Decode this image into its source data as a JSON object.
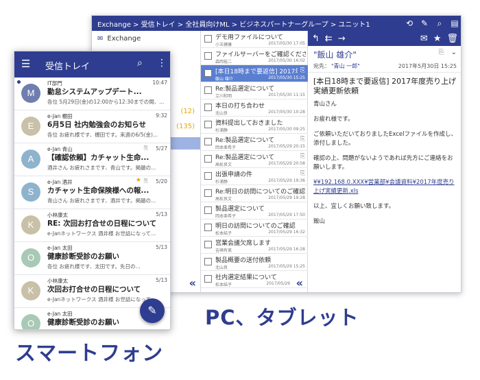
{
  "colors": {
    "brand": "#2e3d8f",
    "selected_row": "#5b7fd0",
    "sidebar_selected": "#9fb3e3",
    "badge": "#e8a400"
  },
  "pc": {
    "breadcrumb": "Exchange > 受信トレイ > 全社員向けML > ビジネスパートナーグループ > ユニット1",
    "toolbar_icons": [
      "sync-icon",
      "edit-icon",
      "search-icon",
      "panel-icon"
    ],
    "folders": [
      {
        "label": "Exchange",
        "icon": "mail-icon",
        "count": ""
      },
      {
        "label": "",
        "count": "(12)"
      },
      {
        "label": "",
        "count": "(135)"
      }
    ],
    "messages": [
      {
        "subject": "デモ用ファイルについて",
        "from": "小玉健康",
        "date": "2017/05/30 17:05",
        "clip": false,
        "selected": false
      },
      {
        "subject": "ファイルサーバーをご確認ください",
        "from": "森岡裕二",
        "date": "2017/05/30 16:02",
        "clip": false,
        "selected": false
      },
      {
        "subject": "[本日18時まで要返信] 2017年度売り上げ実績更新依頼",
        "from": "飯山 雄介",
        "date": "2017/05/30 15:25",
        "clip": true,
        "selected": true
      },
      {
        "subject": "Re:製品選定について",
        "from": "立川和明",
        "date": "2017/05/30 11:15",
        "clip": false,
        "selected": false
      },
      {
        "subject": "本日の打ち合わせ",
        "from": "北山良",
        "date": "2017/05/30 10:28",
        "clip": false,
        "selected": false
      },
      {
        "subject": "資料提出しておきました",
        "from": "杉浦静",
        "date": "2017/05/30 09:25",
        "clip": false,
        "selected": false
      },
      {
        "subject": "Re:製品選定について",
        "from": "岡本亜希子",
        "date": "2017/05/29 20:15",
        "clip": true,
        "selected": false
      },
      {
        "subject": "Re:製品選定について",
        "from": "高松良文",
        "date": "2017/05/29 20:58",
        "clip": true,
        "selected": false
      },
      {
        "subject": "出張申請の件",
        "from": "杉浦静",
        "date": "2017/05/29 19:36",
        "clip": true,
        "selected": false
      },
      {
        "subject": "Re:明日の訪問についてのご確認",
        "from": "高松良文",
        "date": "2017/05/29 19:28",
        "clip": false,
        "selected": false
      },
      {
        "subject": "製品選定について",
        "from": "岡本亜希子",
        "date": "2017/05/29 17:50",
        "clip": false,
        "selected": false
      },
      {
        "subject": "明日の訪問についてのご確認",
        "from": "松本結子",
        "date": "2017/05/29 16:32",
        "clip": false,
        "selected": false
      },
      {
        "subject": "営業会議欠席します",
        "from": "吉崎有美",
        "date": "2017/05/29 16:28",
        "clip": false,
        "selected": false
      },
      {
        "subject": "製品概要の送付依頼",
        "from": "北山良",
        "date": "2017/05/29 15:25",
        "clip": false,
        "selected": false
      },
      {
        "subject": "社内選定結果について",
        "from": "松本結子",
        "date": "2017/05/29",
        "clip": false,
        "selected": false
      }
    ],
    "reader": {
      "sender": "\"飯山 雄介\"",
      "to_label": "宛先：",
      "to": "\"青山 一郎\"",
      "date": "2017年5月30日 15:25",
      "subject": "[本日18時まで要返信] 2017年度売り上げ実績更新依頼",
      "greeting": "青山さん",
      "line1": "お疲れ様です。",
      "line2": "ご依頼いただいておりましたExcelファイルを作成し、添付しました。",
      "line3": "確認の上、問題がないようであれば先方にご連絡をお願いします。",
      "link": "¥¥192.168.0.XXX¥営業部¥会議資料¥2017年度売り上げ実績更新.xls",
      "closing": "以上、宜しくお願い致します。",
      "signature": "飯山"
    }
  },
  "phone": {
    "title": "受信トレイ",
    "items": [
      {
        "avatar": "M",
        "color": "#6f7eaf",
        "unread": true,
        "from": "IT部門",
        "date": "10:47",
        "subject": "勤怠システムアップデート...",
        "preview": "各位 5月29日(金)の12:00から12:30までの間、...",
        "clip": false,
        "star": false
      },
      {
        "avatar": "E",
        "color": "#c9c0a8",
        "unread": false,
        "from": "e-Jan 棚田",
        "date": "9:32",
        "subject": "6月5日 社内勉強会のお知らせ",
        "preview": "各位 お疲れ様です、棚田です。来週の6/5(金)...",
        "clip": false,
        "star": false
      },
      {
        "avatar": "A",
        "color": "#8fb3cd",
        "unread": false,
        "from": "e-Jan 青山",
        "date": "5/27",
        "subject": "【確認依頼】カチャット生命...",
        "preview": "酒井さん お疲れさまです、青山です。掲題の...",
        "clip": true,
        "star": false
      },
      {
        "avatar": "S",
        "color": "#8fb3cd",
        "unread": false,
        "from": "e-Jan 酒井",
        "date": "5/20",
        "subject": "カチャット生命保険様への報...",
        "preview": "青山さん お疲れさまです、酒井です。掲題の...",
        "clip": true,
        "star": true
      },
      {
        "avatar": "K",
        "color": "#c9c0a8",
        "unread": false,
        "from": "小林康太",
        "date": "5/13",
        "subject": "RE: 次回お打合せの日程について",
        "preview": "e-Janネットワークス 酒井様 お世話になって...",
        "clip": false,
        "star": false
      },
      {
        "avatar": "O",
        "color": "#a8c9b6",
        "unread": false,
        "from": "e-Jan 太田",
        "date": "5/13",
        "subject": "健康診断受診のお願い",
        "preview": "各位 お疲れ様です、太田です。先日の...",
        "clip": false,
        "star": false
      },
      {
        "avatar": "K",
        "color": "#c9c0a8",
        "unread": false,
        "from": "小林康太",
        "date": "5/13",
        "subject": "次回お打合せの日程について",
        "preview": "e-Janネットワークス 酒井様 お世話になって...",
        "clip": false,
        "star": false
      },
      {
        "avatar": "O",
        "color": "#a8c9b6",
        "unread": false,
        "from": "e-Jan 太田",
        "date": "",
        "subject": "健康診断受診のお願い",
        "preview": "",
        "clip": false,
        "star": false
      }
    ]
  },
  "captions": {
    "pc": "PC、タブレット",
    "phone": "スマートフォン"
  }
}
